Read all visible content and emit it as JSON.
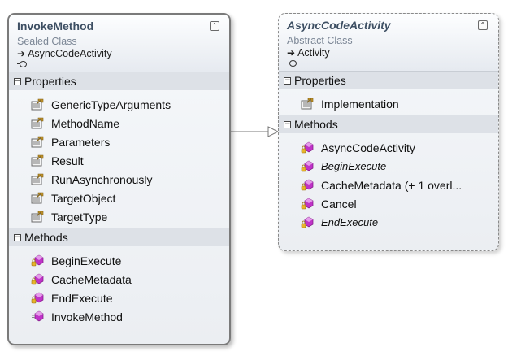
{
  "connector_color": "#7a7a7a",
  "shapes": {
    "invoke_method": {
      "title": "InvokeMethod",
      "stereotype": "Sealed Class",
      "base_type": "AsyncCodeActivity",
      "collapse_icon": "double-chevron-up-icon",
      "properties_header": "Properties",
      "properties": [
        "GenericTypeArguments",
        "MethodName",
        "Parameters",
        "Result",
        "RunAsynchronously",
        "TargetObject",
        "TargetType"
      ],
      "methods_header": "Methods",
      "methods": [
        {
          "name": "BeginExecute",
          "icon": "protected-method-icon"
        },
        {
          "name": "CacheMetadata",
          "icon": "protected-method-icon"
        },
        {
          "name": "EndExecute",
          "icon": "protected-method-icon"
        },
        {
          "name": "InvokeMethod",
          "icon": "public-method-icon"
        }
      ]
    },
    "async_code_activity": {
      "title": "AsyncCodeActivity",
      "stereotype": "Abstract Class",
      "base_type": "Activity",
      "collapse_icon": "double-chevron-up-icon",
      "properties_header": "Properties",
      "properties": [
        "Implementation"
      ],
      "methods_header": "Methods",
      "methods": [
        {
          "name": "AsyncCodeActivity",
          "icon": "protected-method-icon",
          "italic": false
        },
        {
          "name": "BeginExecute",
          "icon": "protected-method-icon",
          "italic": true
        },
        {
          "name": "CacheMetadata (+ 1 overl...",
          "icon": "protected-method-icon",
          "italic": false
        },
        {
          "name": "Cancel",
          "icon": "protected-method-icon",
          "italic": false
        },
        {
          "name": "EndExecute",
          "icon": "protected-method-icon",
          "italic": true
        }
      ]
    }
  }
}
